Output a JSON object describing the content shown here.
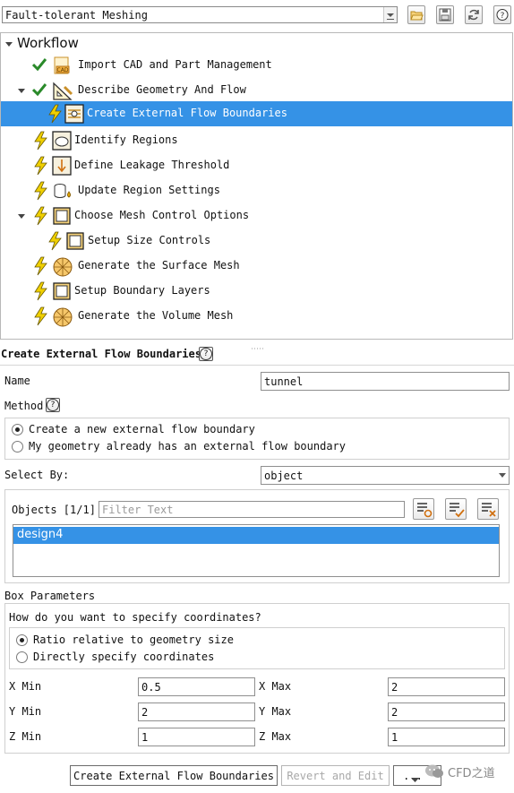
{
  "toolbar": {
    "workflow_select": "Fault-tolerant Meshing"
  },
  "tree": {
    "root_label": "Workflow",
    "items": [
      {
        "label": "Import CAD and Part Management"
      },
      {
        "label": "Describe Geometry And Flow"
      },
      {
        "label": "Create External Flow Boundaries"
      },
      {
        "label": "Identify Regions"
      },
      {
        "label": "Define Leakage Threshold"
      },
      {
        "label": "Update Region Settings"
      },
      {
        "label": "Choose Mesh Control Options"
      },
      {
        "label": "Setup Size Controls"
      },
      {
        "label": "Generate the Surface Mesh"
      },
      {
        "label": "Setup Boundary Layers"
      },
      {
        "label": "Generate the Volume Mesh"
      }
    ]
  },
  "panel": {
    "title": "Create External Flow Boundaries",
    "name_label": "Name",
    "name_value": "tunnel",
    "method_label": "Method",
    "method_options": [
      "Create a new external flow boundary",
      "My geometry already has an external flow boundary"
    ],
    "select_by_label": "Select By:",
    "select_by_value": "object",
    "objects_label": "Objects [1/1]",
    "filter_placeholder": "Filter Text",
    "objects": [
      "design4"
    ],
    "box_params_label": "Box Parameters",
    "coord_question": "How do you want to specify coordinates?",
    "coord_options": [
      "Ratio relative to geometry size",
      "Directly specify coordinates"
    ],
    "xmin_label": "X Min",
    "xmin": "0.5",
    "xmax_label": "X Max",
    "xmax": "2",
    "ymin_label": "Y Min",
    "ymin": "2",
    "ymax_label": "Y Max",
    "ymax": "2",
    "zmin_label": "Z Min",
    "zmin": "1",
    "zmax_label": "Z Max",
    "zmax": "1"
  },
  "buttons": {
    "create": "Create External Flow Boundaries",
    "revert": "Revert and Edit",
    "more": "..."
  },
  "watermark": "CFD之道",
  "colors": {
    "selection": "#3592e6",
    "check": "#2a8a2a",
    "bolt": "#f0d000"
  }
}
